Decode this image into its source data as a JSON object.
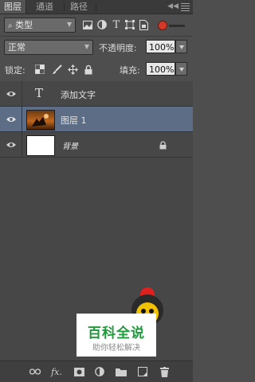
{
  "tabs": [
    "图层",
    "通道",
    "路径"
  ],
  "panel_menu": {
    "collapse_glyph": "◀◀",
    "menu_icon": "panel-menu-icon"
  },
  "filter": {
    "kind_label": "类型",
    "kind_icon": "search-icon",
    "toggle_on": true
  },
  "blend": {
    "mode": "正常",
    "opacity_label": "不透明度:",
    "opacity_value": "100%"
  },
  "lock": {
    "label": "锁定:",
    "fill_label": "填充:",
    "fill_value": "100%"
  },
  "layers": [
    {
      "type": "text",
      "name": "添加文字",
      "visible": true,
      "selected": false
    },
    {
      "type": "image",
      "name": "图层 1",
      "visible": true,
      "selected": true
    },
    {
      "type": "background",
      "name": "背景",
      "visible": true,
      "selected": false,
      "locked": true
    }
  ],
  "bottom_bar_icons": [
    "link-layers-icon",
    "fx-icon",
    "add-mask-icon",
    "adjustment-layer-icon",
    "new-group-icon",
    "new-layer-icon",
    "delete-layer-icon"
  ],
  "fx_glyph": "fx.",
  "watermark": {
    "title": "百科全说",
    "subtitle": "助你轻松解决"
  },
  "colors": {
    "panel": "#535353",
    "layers_bg": "#474747",
    "selected_row": "#5c6d85",
    "watermark_green": "#1e9b3a"
  }
}
